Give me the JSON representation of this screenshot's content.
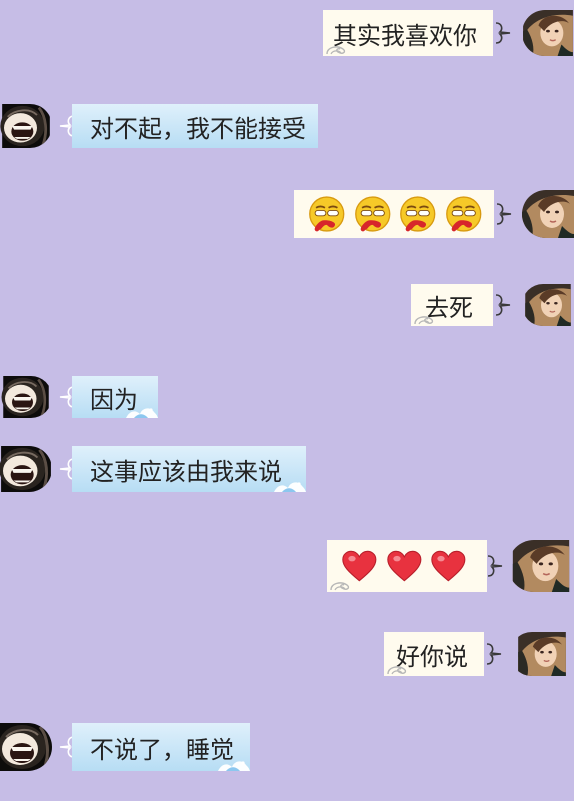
{
  "messages": [
    {
      "side": "right",
      "text": "其实我喜欢你"
    },
    {
      "side": "left",
      "text": "对不起，我不能接受"
    },
    {
      "side": "right",
      "emoji": "nosebleed-face",
      "count": 4
    },
    {
      "side": "right",
      "text": "去死"
    },
    {
      "side": "left",
      "text": "因为"
    },
    {
      "side": "left",
      "text": "这事应该由我来说"
    },
    {
      "side": "right",
      "emoji": "red-heart",
      "count": 3
    },
    {
      "side": "right",
      "text": "好你说"
    },
    {
      "side": "left",
      "text": "不说了，睡觉"
    }
  ],
  "colors": {
    "background": "#c6bde6",
    "right_bubble": "#fffbee",
    "left_bubble_top": "#dff0fb",
    "left_bubble_bottom": "#b7ddf4",
    "heart": "#e8323f",
    "emoji_face": "#f6c928",
    "nose_blood": "#d7262b"
  }
}
